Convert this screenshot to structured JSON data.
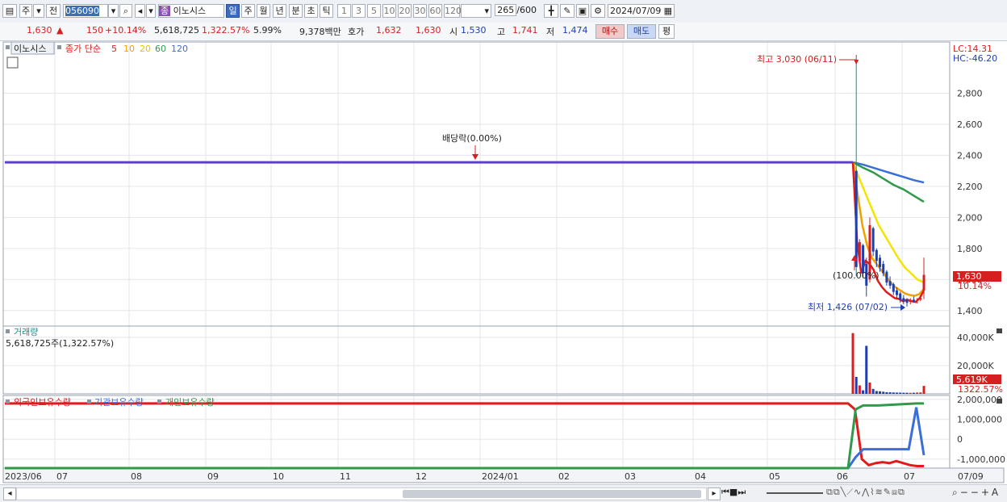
{
  "toolbar": {
    "type_label": "주",
    "prev_label": "전",
    "code": "056090",
    "stock_badge": "종",
    "stock_name": "이노시스",
    "periods": [
      "일",
      "주",
      "월",
      "년",
      "분",
      "초",
      "틱"
    ],
    "active_period": "일",
    "intervals": [
      "1",
      "3",
      "5",
      "10",
      "20",
      "30",
      "60",
      "120"
    ],
    "count": "265",
    "count_total": "/600",
    "date": "2024/07/09"
  },
  "quote": {
    "price": "1,630",
    "change_arrow": "▲",
    "change": "150",
    "change_pct": "+10.14%",
    "volume": "5,618,725",
    "volume_pct": "1,322.57%",
    "turnover_pct": "5.99%",
    "amount": "9,378백만",
    "bid_label": "호가",
    "bid": "1,632",
    "ask": "1,630",
    "open_label": "시",
    "open": "1,530",
    "high_label": "고",
    "high": "1,741",
    "low_label": "저",
    "low": "1,474",
    "buy_label": "매수",
    "sell_label": "매도",
    "avg_label": "평"
  },
  "price_panel": {
    "stock_label": "이노시스",
    "ma_title": "종가 단순",
    "ma_periods": [
      "5",
      "10",
      "20",
      "60",
      "120"
    ],
    "lc": "LC:14.31",
    "hc": "HC:-46.20",
    "annotation_high": "최고 3,030 (06/11)",
    "annotation_low": "최저 1,426 (07/02)",
    "annotation_dividend": "배당락(0.00%)",
    "annotation_event": "(100.00%)",
    "last_price": "1,630",
    "last_pct": "10.14%"
  },
  "volume_panel": {
    "title": "거래량",
    "subtitle": "5,618,725주(1,322.57%)",
    "last_value": "5,619K",
    "last_pct": "1322.57%"
  },
  "holder_panel": {
    "series_labels": [
      "외국인보유수량",
      "기관보유수량",
      "개인보유수량"
    ]
  },
  "x_axis_labels": [
    "2023/06",
    "07",
    "08",
    "09",
    "10",
    "11",
    "12",
    "2024/01",
    "02",
    "03",
    "04",
    "05",
    "06",
    "07",
    "07/09"
  ],
  "colors": {
    "up": "#d42020",
    "down": "#1d3fb0",
    "ma5": "#e01b1b",
    "ma10": "#f0a000",
    "ma20": "#f5e400",
    "ma60": "#2e9a4a",
    "ma120": "#3a6fd8",
    "volume_label": "#1a8a8a"
  },
  "chart_data": [
    {
      "type": "candlestick",
      "panel": "price",
      "y_ticks": [
        1400,
        1600,
        1800,
        2000,
        2200,
        2400,
        2600,
        2800
      ],
      "ylim": [
        1300,
        3130
      ],
      "flat_price_before_listing": 2355,
      "high": {
        "date": "2024/06/11",
        "value": 3030
      },
      "low": {
        "date": "2024/07/02",
        "value": 1426
      },
      "dividend_marker_date": "2024/01",
      "candles": [
        {
          "d": "06/10",
          "o": 2355,
          "h": 2355,
          "l": 2355,
          "c": 2355
        },
        {
          "d": "06/11",
          "o": 2300,
          "h": 3030,
          "l": 1620,
          "c": 1680
        },
        {
          "d": "06/12",
          "o": 1720,
          "h": 1860,
          "l": 1700,
          "c": 1840
        },
        {
          "d": "06/13",
          "o": 1820,
          "h": 1830,
          "l": 1610,
          "c": 1640
        },
        {
          "d": "06/14",
          "o": 1700,
          "h": 1740,
          "l": 1490,
          "c": 1560
        },
        {
          "d": "06/17",
          "o": 1600,
          "h": 2000,
          "l": 1580,
          "c": 1950
        },
        {
          "d": "06/18",
          "o": 1930,
          "h": 1940,
          "l": 1750,
          "c": 1780
        },
        {
          "d": "06/19",
          "o": 1790,
          "h": 1800,
          "l": 1680,
          "c": 1720
        },
        {
          "d": "06/20",
          "o": 1740,
          "h": 1760,
          "l": 1650,
          "c": 1680
        },
        {
          "d": "06/21",
          "o": 1700,
          "h": 1720,
          "l": 1620,
          "c": 1640
        },
        {
          "d": "06/24",
          "o": 1650,
          "h": 1660,
          "l": 1560,
          "c": 1580
        },
        {
          "d": "06/25",
          "o": 1590,
          "h": 1620,
          "l": 1540,
          "c": 1560
        },
        {
          "d": "06/26",
          "o": 1570,
          "h": 1580,
          "l": 1500,
          "c": 1520
        },
        {
          "d": "06/27",
          "o": 1530,
          "h": 1550,
          "l": 1480,
          "c": 1500
        },
        {
          "d": "06/28",
          "o": 1510,
          "h": 1520,
          "l": 1450,
          "c": 1470
        },
        {
          "d": "07/01",
          "o": 1480,
          "h": 1500,
          "l": 1440,
          "c": 1460
        },
        {
          "d": "07/02",
          "o": 1470,
          "h": 1480,
          "l": 1426,
          "c": 1450
        },
        {
          "d": "07/03",
          "o": 1455,
          "h": 1480,
          "l": 1440,
          "c": 1470
        },
        {
          "d": "07/04",
          "o": 1470,
          "h": 1490,
          "l": 1450,
          "c": 1460
        },
        {
          "d": "07/05",
          "o": 1460,
          "h": 1480,
          "l": 1445,
          "c": 1465
        },
        {
          "d": "07/08",
          "o": 1470,
          "h": 1500,
          "l": 1460,
          "c": 1480
        },
        {
          "d": "07/09",
          "o": 1530,
          "h": 1741,
          "l": 1474,
          "c": 1630
        }
      ],
      "ma": {
        "ma5": [
          2355,
          1850,
          1640,
          1720,
          1700,
          1660,
          1590,
          1550,
          1520,
          1500,
          1480,
          1475,
          1460,
          1470,
          1460,
          1455,
          1480,
          1530
        ],
        "ma10": [
          2355,
          2150,
          1950,
          1820,
          1740,
          1700,
          1660,
          1620,
          1580,
          1550,
          1530,
          1510,
          1500,
          1495,
          1505,
          1540
        ],
        "ma20": [
          2355,
          2250,
          2150,
          2050,
          1950,
          1880,
          1810,
          1740,
          1680,
          1640,
          1600,
          1580
        ],
        "ma60": [
          2355,
          2320,
          2290,
          2250,
          2210,
          2180,
          2140,
          2100
        ],
        "ma120": [
          2355,
          2340,
          2320,
          2300,
          2280,
          2260,
          2240,
          2225
        ]
      }
    },
    {
      "type": "bar",
      "panel": "volume",
      "y_ticks": [
        "20,000K",
        "40,000K"
      ],
      "ylim": [
        0,
        48000
      ],
      "values_k": [
        43000,
        12000,
        6000,
        2500,
        34000,
        8000,
        3500,
        2000,
        1800,
        1500,
        1200,
        1100,
        1000,
        900,
        900,
        800,
        800,
        700,
        800,
        900,
        1000,
        5619
      ]
    },
    {
      "type": "line",
      "panel": "holders",
      "y_ticks": [
        "2,000,000",
        "1,000,000",
        "0",
        "-1,000,000"
      ],
      "ylim": [
        -1450000,
        2200000
      ],
      "series": [
        {
          "name": "외국인보유수량",
          "before": 1800000,
          "after": [
            1800000,
            1500000,
            -1000000,
            -1300000,
            -1200000,
            -1150000,
            -1200000,
            -1100000,
            -1200000,
            -1300000,
            -1350000,
            -1350000
          ]
        },
        {
          "name": "기관보유수량",
          "before": -1450000,
          "after": [
            -1450000,
            -900000,
            -500000,
            -500000,
            -500000,
            -500000,
            -500000,
            -500000,
            -500000,
            1600000,
            -800000
          ]
        },
        {
          "name": "개인보유수량",
          "before": -1450000,
          "after": [
            -1450000,
            1500000,
            1700000,
            1700000,
            1700000,
            1720000,
            1740000,
            1760000,
            1780000,
            1800000,
            1800000
          ]
        }
      ]
    }
  ]
}
